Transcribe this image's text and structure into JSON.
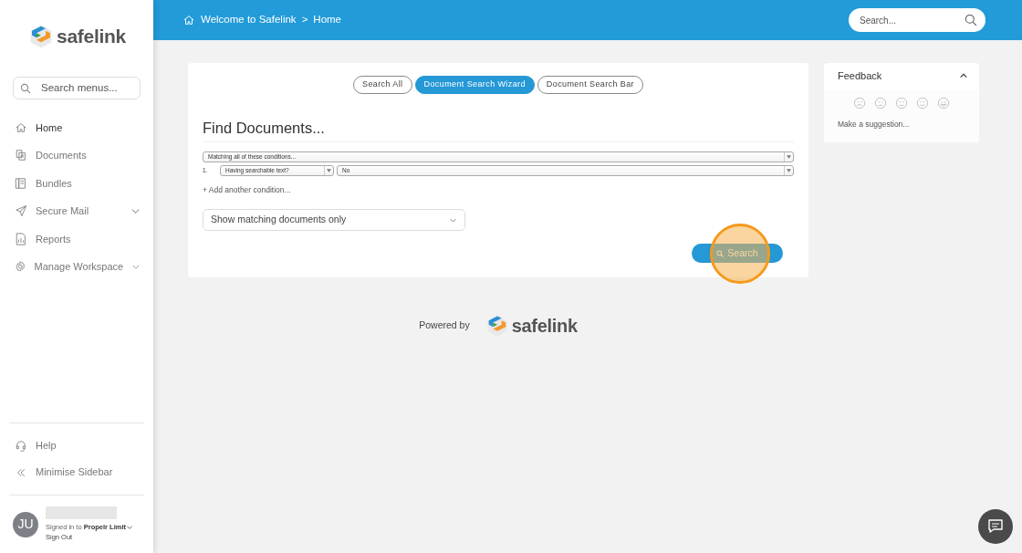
{
  "sidebar": {
    "logo_text": "safelink",
    "search": {
      "placeholder": "Search menus..."
    },
    "items": [
      {
        "label": "Home",
        "kind": "home",
        "selected": true,
        "expandable": false
      },
      {
        "label": "Documents",
        "kind": "documents",
        "selected": false,
        "expandable": false
      },
      {
        "label": "Bundles",
        "kind": "bundles",
        "selected": false,
        "expandable": false
      },
      {
        "label": "Secure Mail",
        "kind": "send",
        "selected": false,
        "expandable": true
      },
      {
        "label": "Reports",
        "kind": "report",
        "selected": false,
        "expandable": false
      },
      {
        "label": "Manage Workspace",
        "kind": "gear",
        "selected": false,
        "expandable": true
      }
    ],
    "footer_items": [
      {
        "label": "Help",
        "kind": "headset"
      },
      {
        "label": "Minimise Sidebar",
        "kind": "chevrons"
      }
    ],
    "user": {
      "initials": "JU",
      "signed_in_label": "Signed in to",
      "workspace": "Propelr Limit",
      "sign_out": "Sign Out"
    }
  },
  "header": {
    "breadcrumb": [
      "Welcome to Safelink",
      "Home"
    ],
    "separator": ">",
    "search": {
      "placeholder": "Search..."
    }
  },
  "search_tabs": [
    {
      "label": "Search All",
      "selected": false
    },
    {
      "label": "Document Search Wizard",
      "selected": true
    },
    {
      "label": "Document Search Bar",
      "selected": false
    }
  ],
  "heading": "Find Documents...",
  "match_select": "Matching all of these conditions...",
  "conditions": [
    {
      "number": "1.",
      "field": "Having searchable text?",
      "value": "No"
    }
  ],
  "add_condition": "+ Add another condition...",
  "display_select": "Show matching documents only",
  "search_button": {
    "label": "Search",
    "highlighted": true
  },
  "feedback": {
    "title": "Feedback",
    "expanded": true,
    "suggestion": "Make a suggestion..."
  },
  "powered_by": {
    "label": "Powered by",
    "logo_text": "safelink"
  }
}
